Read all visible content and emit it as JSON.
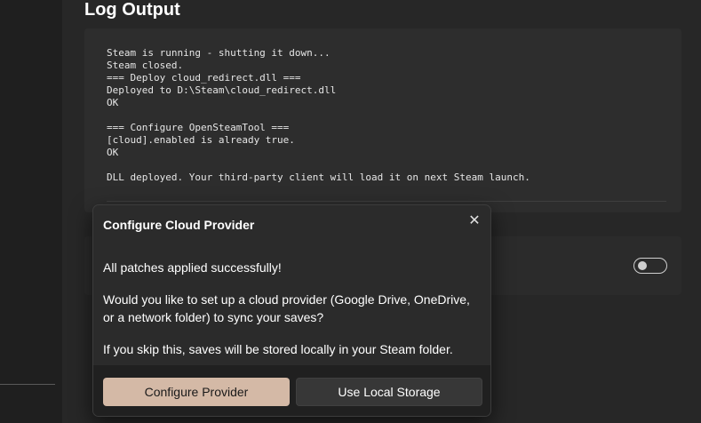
{
  "page": {
    "title": "Log Output"
  },
  "log": {
    "lines": [
      "Steam is running - shutting it down...",
      "Steam closed.",
      "=== Deploy cloud_redirect.dll ===",
      "Deployed to D:\\Steam\\cloud_redirect.dll",
      "OK",
      "",
      "=== Configure OpenSteamTool ===",
      "[cloud].enabled is already true.",
      "OK",
      "",
      "DLL deployed. Your third-party client will load it on next Steam launch."
    ]
  },
  "setting": {
    "toggle_state": "off"
  },
  "dialog": {
    "title": "Configure Cloud Provider",
    "close_icon": "close-icon",
    "paragraph1": "All patches applied successfully!",
    "paragraph2": "Would you like to set up a cloud provider (Google Drive, OneDrive, or a network folder) to sync your saves?",
    "paragraph3": "If you skip this, saves will be stored locally in your Steam folder.",
    "primary_button": "Configure Provider",
    "secondary_button": "Use Local Storage"
  },
  "colors": {
    "accent": "#d4b9a6",
    "background": "#272727",
    "dialog_background": "#2b2b2b"
  }
}
